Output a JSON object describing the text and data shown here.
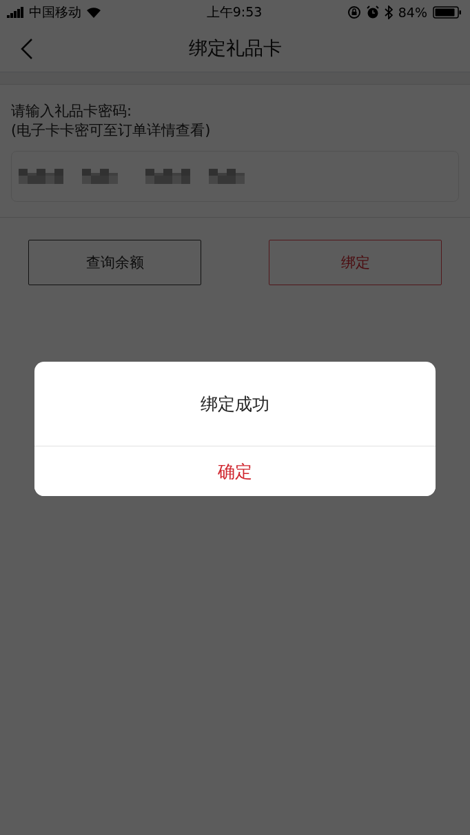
{
  "status_bar": {
    "carrier": "中国移动",
    "time": "上午9:53",
    "battery": "84%"
  },
  "nav": {
    "title": "绑定礼品卡"
  },
  "form": {
    "label": "请输入礼品卡密码:",
    "hint": "(电子卡卡密可至订单详情查看)"
  },
  "buttons": [
    {
      "label": "查询余额",
      "kind": "secondary"
    },
    {
      "label": "绑定",
      "kind": "primary"
    }
  ],
  "dialog": {
    "message": "绑定成功",
    "confirm": "确定"
  }
}
